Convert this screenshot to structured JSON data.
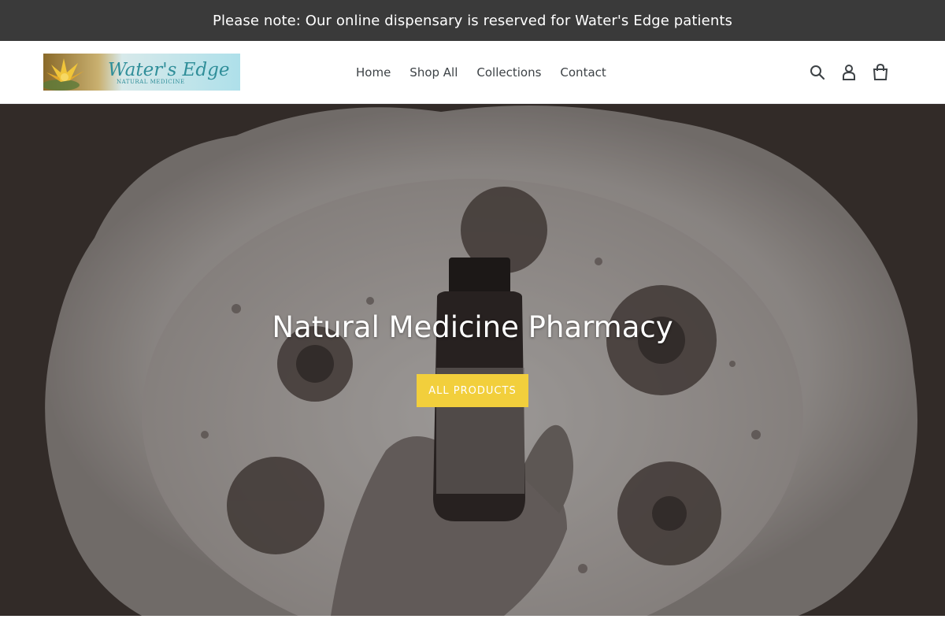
{
  "announcement": {
    "text": "Please note: Our online dispensary is reserved for Water's Edge patients"
  },
  "header": {
    "logo": {
      "title": "Water's Edge",
      "subtitle": "NATURAL MEDICINE"
    },
    "nav": [
      {
        "label": "Home"
      },
      {
        "label": "Shop All"
      },
      {
        "label": "Collections"
      },
      {
        "label": "Contact"
      }
    ],
    "icons": [
      "search-icon",
      "account-icon",
      "cart-icon"
    ]
  },
  "hero": {
    "title": "Natural Medicine Pharmacy",
    "button_label": "ALL PRODUCTS"
  },
  "colors": {
    "announcement_bg": "#3a3a3a",
    "button_bg": "#f2cf3c",
    "text": "#3d4246"
  }
}
